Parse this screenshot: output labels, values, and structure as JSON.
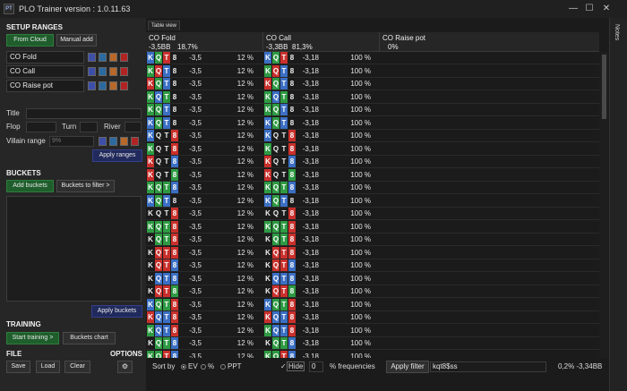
{
  "window": {
    "title": "PLO Trainer version : 1.0.11.63",
    "icon_text": "PT",
    "minimize_glyph": "—",
    "maximize_glyph": "☐",
    "close_glyph": "✕"
  },
  "left_panel": {
    "setup_ranges_title": "SETUP RANGES",
    "from_cloud_label": "From Cloud",
    "manual_add_label": "Manual add",
    "ranges": [
      "CO Fold",
      "CO Call",
      "CO Raise pot"
    ],
    "title_label": "Title",
    "flop_label": "Flop",
    "turn_label": "Turn",
    "river_label": "River",
    "villain_range_label": "Villain range",
    "villain_range_placeholder": "9%",
    "apply_ranges_label": "Apply ranges",
    "buckets_title": "BUCKETS",
    "add_buckets_label": "Add buckets",
    "buckets_to_filter_label": "Buckets to filter >",
    "apply_buckets_label": "Apply buckets",
    "training_title": "TRAINING",
    "start_training_label": "Start training >",
    "buckets_chart_label": "Buckets chart",
    "file_title": "FILE",
    "options_title": "OPTIONS",
    "save_label": "Save",
    "load_label": "Load",
    "clear_label": "Clear"
  },
  "main": {
    "tab_label": "Table view",
    "columns": [
      {
        "name": "CO Fold",
        "ev": "-3,5BB",
        "freq": "18,7%"
      },
      {
        "name": "CO Call",
        "ev": "-3,3BB",
        "freq": "81,3%"
      },
      {
        "name": "CO Raise pot",
        "ev": "",
        "freq": "0%"
      }
    ],
    "rows": [
      {
        "cards": [
          "K",
          "Q",
          "T",
          "8"
        ],
        "colors": [
          "b",
          "g",
          "r",
          "k"
        ],
        "fold_ev": "-3,5",
        "fold_pct": "12 %",
        "call_ev": "-3,18",
        "call_pct": "100 %"
      },
      {
        "cards": [
          "K",
          "Q",
          "T",
          "8"
        ],
        "colors": [
          "g",
          "r",
          "b",
          "k"
        ],
        "fold_ev": "-3,5",
        "fold_pct": "12 %",
        "call_ev": "-3,18",
        "call_pct": "100 %"
      },
      {
        "cards": [
          "K",
          "Q",
          "T",
          "8"
        ],
        "colors": [
          "r",
          "g",
          "b",
          "k"
        ],
        "fold_ev": "-3,5",
        "fold_pct": "12 %",
        "call_ev": "-3,18",
        "call_pct": "100 %"
      },
      {
        "cards": [
          "K",
          "Q",
          "T",
          "8"
        ],
        "colors": [
          "g",
          "b",
          "g",
          "k"
        ],
        "fold_ev": "-3,5",
        "fold_pct": "12 %",
        "call_ev": "-3,18",
        "call_pct": "100 %"
      },
      {
        "cards": [
          "K",
          "Q",
          "T",
          "8"
        ],
        "colors": [
          "g",
          "g",
          "b",
          "k"
        ],
        "fold_ev": "-3,5",
        "fold_pct": "12 %",
        "call_ev": "-3,18",
        "call_pct": "100 %"
      },
      {
        "cards": [
          "K",
          "Q",
          "T",
          "8"
        ],
        "colors": [
          "b",
          "g",
          "b",
          "k"
        ],
        "fold_ev": "-3,5",
        "fold_pct": "12 %",
        "call_ev": "-3,18",
        "call_pct": "100 %"
      },
      {
        "cards": [
          "K",
          "Q",
          "T",
          "8"
        ],
        "colors": [
          "b",
          "k",
          "k",
          "r"
        ],
        "fold_ev": "-3,5",
        "fold_pct": "12 %",
        "call_ev": "-3,18",
        "call_pct": "100 %"
      },
      {
        "cards": [
          "K",
          "Q",
          "T",
          "8"
        ],
        "colors": [
          "g",
          "k",
          "k",
          "r"
        ],
        "fold_ev": "-3,5",
        "fold_pct": "12 %",
        "call_ev": "-3,18",
        "call_pct": "100 %"
      },
      {
        "cards": [
          "K",
          "Q",
          "T",
          "8"
        ],
        "colors": [
          "r",
          "k",
          "k",
          "b"
        ],
        "fold_ev": "-3,5",
        "fold_pct": "12 %",
        "call_ev": "-3,18",
        "call_pct": "100 %"
      },
      {
        "cards": [
          "K",
          "Q",
          "T",
          "8"
        ],
        "colors": [
          "r",
          "k",
          "k",
          "g"
        ],
        "fold_ev": "-3,5",
        "fold_pct": "12 %",
        "call_ev": "-3,18",
        "call_pct": "100 %"
      },
      {
        "cards": [
          "K",
          "Q",
          "T",
          "8"
        ],
        "colors": [
          "g",
          "g",
          "g",
          "b"
        ],
        "fold_ev": "-3,5",
        "fold_pct": "12 %",
        "call_ev": "-3,18",
        "call_pct": "100 %"
      },
      {
        "cards": [
          "K",
          "Q",
          "T",
          "8"
        ],
        "colors": [
          "b",
          "g",
          "b",
          "k"
        ],
        "fold_ev": "-3,5",
        "fold_pct": "12 %",
        "call_ev": "-3,18",
        "call_pct": "100 %"
      },
      {
        "cards": [
          "K",
          "Q",
          "T",
          "8"
        ],
        "colors": [
          "k",
          "k",
          "k",
          "r"
        ],
        "fold_ev": "-3,5",
        "fold_pct": "12 %",
        "call_ev": "-3,18",
        "call_pct": "100 %"
      },
      {
        "cards": [
          "K",
          "Q",
          "T",
          "8"
        ],
        "colors": [
          "g",
          "g",
          "g",
          "r"
        ],
        "fold_ev": "-3,5",
        "fold_pct": "12 %",
        "call_ev": "-3,18",
        "call_pct": "100 %"
      },
      {
        "cards": [
          "K",
          "Q",
          "T",
          "8"
        ],
        "colors": [
          "k",
          "g",
          "g",
          "r"
        ],
        "fold_ev": "-3,5",
        "fold_pct": "12 %",
        "call_ev": "-3,18",
        "call_pct": "100 %"
      },
      {
        "cards": [
          "K",
          "Q",
          "T",
          "8"
        ],
        "colors": [
          "k",
          "r",
          "r",
          "r"
        ],
        "fold_ev": "-3,5",
        "fold_pct": "12 %",
        "call_ev": "-3,18",
        "call_pct": "100 %"
      },
      {
        "cards": [
          "K",
          "Q",
          "T",
          "8"
        ],
        "colors": [
          "k",
          "r",
          "r",
          "b"
        ],
        "fold_ev": "-3,5",
        "fold_pct": "12 %",
        "call_ev": "-3,18",
        "call_pct": "100 %"
      },
      {
        "cards": [
          "K",
          "Q",
          "T",
          "8"
        ],
        "colors": [
          "k",
          "b",
          "b",
          "b"
        ],
        "fold_ev": "-3,5",
        "fold_pct": "12 %",
        "call_ev": "-3,18",
        "call_pct": "100 %"
      },
      {
        "cards": [
          "K",
          "Q",
          "T",
          "8"
        ],
        "colors": [
          "k",
          "r",
          "r",
          "g"
        ],
        "fold_ev": "-3,5",
        "fold_pct": "12 %",
        "call_ev": "-3,18",
        "call_pct": "100 %"
      },
      {
        "cards": [
          "K",
          "Q",
          "T",
          "8"
        ],
        "colors": [
          "b",
          "g",
          "g",
          "r"
        ],
        "fold_ev": "-3,5",
        "fold_pct": "12 %",
        "call_ev": "-3,18",
        "call_pct": "100 %"
      },
      {
        "cards": [
          "K",
          "Q",
          "T",
          "8"
        ],
        "colors": [
          "r",
          "b",
          "b",
          "r"
        ],
        "fold_ev": "-3,5",
        "fold_pct": "12 %",
        "call_ev": "-3,18",
        "call_pct": "100 %"
      },
      {
        "cards": [
          "K",
          "Q",
          "T",
          "8"
        ],
        "colors": [
          "g",
          "b",
          "b",
          "r"
        ],
        "fold_ev": "-3,5",
        "fold_pct": "12 %",
        "call_ev": "-3,18",
        "call_pct": "100 %"
      },
      {
        "cards": [
          "K",
          "Q",
          "T",
          "8"
        ],
        "colors": [
          "k",
          "g",
          "g",
          "b"
        ],
        "fold_ev": "-3,5",
        "fold_pct": "12 %",
        "call_ev": "-3,18",
        "call_pct": "100 %"
      },
      {
        "cards": [
          "K",
          "Q",
          "T",
          "8"
        ],
        "colors": [
          "g",
          "g",
          "r",
          "b"
        ],
        "fold_ev": "-3,5",
        "fold_pct": "12 %",
        "call_ev": "-3,18",
        "call_pct": "100 %"
      },
      {
        "cards": [
          "K",
          "Q",
          "T",
          "8"
        ],
        "colors": [
          "b",
          "b",
          "g",
          "r"
        ],
        "fold_ev": "-3,5",
        "fold_pct": "12 %",
        "call_ev": "-3,18",
        "call_pct": "100 %"
      }
    ],
    "sort_by_label": "Sort by",
    "ev_label": "EV",
    "percent_label": "%",
    "ppt_label": "PPT",
    "hide_label": "Hide",
    "hide_value": "0",
    "freq_label": "% frequencies",
    "apply_filter_label": "Apply filter",
    "filter_value": "kqt8$ss",
    "total_summary": "0,2%  -3,34BB"
  },
  "notes": {
    "label": "Notes"
  }
}
